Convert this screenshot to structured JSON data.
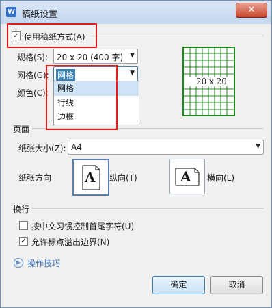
{
  "window": {
    "title": "稿纸设置",
    "app_icon": "W",
    "close_glyph": "✕"
  },
  "use_grid_paper": {
    "label": "使用稿纸方式(A)",
    "checked": true,
    "check_glyph": "✓"
  },
  "spec": {
    "label": "规格(S):",
    "value": "20 x 20 (400 字)"
  },
  "grid": {
    "label": "网格(G):",
    "value": "网格",
    "options": [
      "网格",
      "行线",
      "边框"
    ],
    "selected": "网格"
  },
  "color": {
    "label": "颜色(C):"
  },
  "preview": {
    "text": "20 x 20",
    "grid_color": "#1d8a1d"
  },
  "page_section": {
    "heading": "页面"
  },
  "paper_size": {
    "label": "纸张大小(Z):",
    "value": "A4"
  },
  "paper_orientation": {
    "label": "纸张方向",
    "portrait_label": "纵向(T)",
    "landscape_label": "横向(L)",
    "portrait_glyph": "A",
    "landscape_glyph": "A",
    "selected": "portrait"
  },
  "linebreak_section": {
    "heading": "换行",
    "option1": {
      "label": "按中文习惯控制首尾字符(U)",
      "checked": false
    },
    "option2": {
      "label": "允许标点溢出边界(N)",
      "checked": true,
      "check_glyph": "✓"
    }
  },
  "tips": {
    "label": "操作技巧"
  },
  "buttons": {
    "ok": "确定",
    "cancel": "取消"
  },
  "colors": {
    "highlight": "#e41b1b",
    "titlebar": "#c4d6ee",
    "selected_item": "#cfe3f7"
  }
}
